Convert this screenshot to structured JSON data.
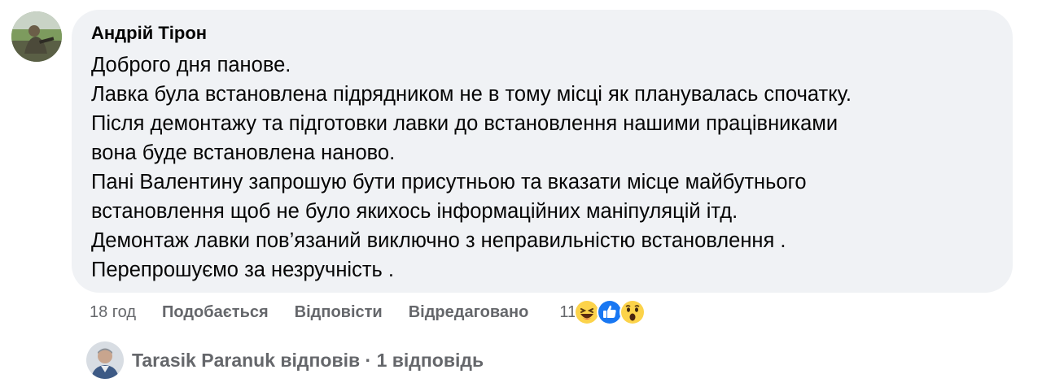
{
  "comment": {
    "author": "Андрій Тірон",
    "lines": [
      "Доброго дня панове.",
      "Лавка була встановлена підрядником не в тому місці як планувалась спочатку.",
      "Після демонтажу та підготовки лавки до встановлення нашими працівниками",
      "вона буде встановлена наново.",
      "Пані Валентину запрошую бути присутньою та вказати місце майбутнього",
      "встановлення щоб не було якихось інформаційних маніпуляцій ітд.",
      "Демонтаж лавки пов’язаний виключно з неправильністю встановлення .",
      "Перепрошуємо за незручність ."
    ]
  },
  "actions": {
    "time": "18 год",
    "like_label": "Подобається",
    "reply_label": "Відповісти",
    "edited_label": "Відредаговано"
  },
  "reactions": {
    "count": "11",
    "icons": [
      "haha-icon",
      "like-icon",
      "wow-icon"
    ]
  },
  "replies": {
    "text": "Tarasik Paranuk відповів · 1 відповідь"
  },
  "colors": {
    "bubble": "#f0f2f5",
    "secondary_text": "#65676b",
    "like_blue": "#1877f2",
    "emoji_yellow": "#fcd34a"
  }
}
